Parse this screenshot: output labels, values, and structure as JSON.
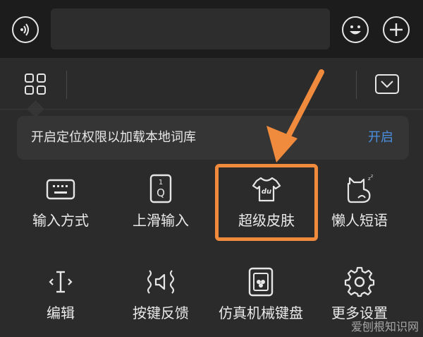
{
  "banner": {
    "text": "开启定位权限以加载本地词库",
    "action": "开启"
  },
  "tiles_row1": [
    {
      "label": "输入方式",
      "icon": "keyboard-icon"
    },
    {
      "label": "上滑输入",
      "icon": "swipe-up-key-icon"
    },
    {
      "label": "超级皮肤",
      "icon": "skin-tshirt-icon"
    },
    {
      "label": "懒人短语",
      "icon": "lazy-cat-icon"
    }
  ],
  "tiles_row2": [
    {
      "label": "编辑",
      "icon": "text-cursor-icon"
    },
    {
      "label": "按键反馈",
      "icon": "key-feedback-icon"
    },
    {
      "label": "仿真机械键盘",
      "icon": "mechanical-keyboard-icon"
    },
    {
      "label": "更多设置",
      "icon": "gear-icon"
    }
  ],
  "skin_icon_text": "du",
  "swipe_key_top": "1",
  "swipe_key_letter": "Q",
  "watermark": "爱刨根知识网",
  "colors": {
    "accent": "#4a90e2",
    "highlight": "#f08a3c",
    "background": "#2b2b2b",
    "topbar": "#1c1c1c"
  }
}
